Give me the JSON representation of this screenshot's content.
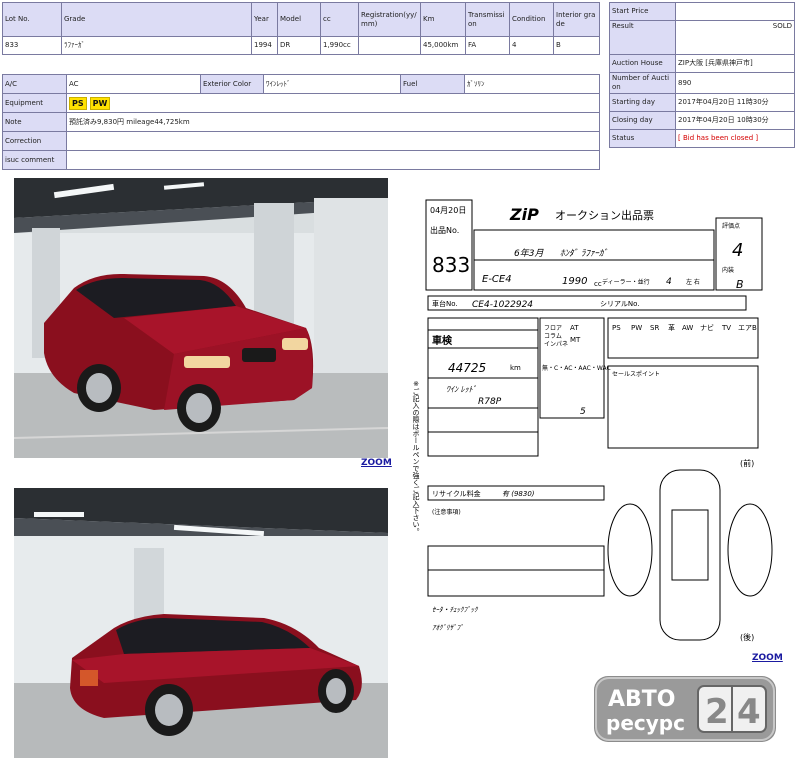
{
  "lot_table": {
    "headers": [
      "Lot No.",
      "Grade",
      "Year",
      "Model",
      "cc",
      "Registration(yy/mm)",
      "Km",
      "Transmission",
      "Condition",
      "Interior grade"
    ],
    "values": [
      "833",
      "ﾗﾌｧｰｶﾞ",
      "1994",
      "DR",
      "1,990cc",
      "",
      "45,000km",
      "FA",
      "4",
      "B"
    ]
  },
  "details": {
    "ac_label": "A/C",
    "ac_value": "AC",
    "exterior_color_label": "Exterior Color",
    "exterior_color_value": "ﾜｲﾝﾚｯﾄﾞ",
    "fuel_label": "Fuel",
    "fuel_value": "ｶﾞｿﾘﾝ",
    "equipment_label": "Equipment",
    "equipment_badges": [
      "PS",
      "PW"
    ],
    "note_label": "Note",
    "note_value": "預託済み9,830円 mileage44,725km",
    "correction_label": "Correction",
    "correction_value": "",
    "issue_comment_label": "isuc comment",
    "issue_comment_value": ""
  },
  "auction": {
    "start_price_label": "Start Price",
    "start_price_value": "",
    "result_label": "Result",
    "result_value": "SOLD",
    "auction_house_label": "Auction House",
    "auction_house_value": "ZIP大阪 [兵庫県神戸市]",
    "number_label": "Number of Auction",
    "number_value": "890",
    "starting_day_label": "Starting day",
    "starting_day_value": "2017年04月20日 11時30分",
    "closing_day_label": "Closing day",
    "closing_day_value": "2017年04月20日 10時30分",
    "status_label": "Status",
    "status_value": "[ Bid has been closed ]"
  },
  "zoom_label": "ZOOM",
  "sheet": {
    "date": "04月20日",
    "lot_label": "出品No.",
    "lot": "833",
    "title": "オークション出品票",
    "brand": "ZiP",
    "grade_score": "4",
    "interior_label": "内装",
    "interior_score": "B",
    "grade_label": "評価点",
    "model_text": "ﾎﾝﾀﾞ ﾗﾌｧｰｶﾞ",
    "year_text": "6年3月",
    "chassis_code": "E-CE4",
    "chassis_full": "CE4-1022924",
    "cc_text": "1990",
    "cc_unit": "cc",
    "dealer_label": "ディーラー・並行",
    "doors": "4",
    "handle": "左 右",
    "frame_label": "車台No.",
    "serial_label": "シリアルNo.",
    "shaken_label": "車検",
    "mileage_text": "44725",
    "mileage_unit": "km",
    "color_text": "ﾜｲﾝ ﾚｯﾄﾞ",
    "color_code": "R78P",
    "seats_text": "5",
    "recycle_label": "リサイクル料金",
    "recycle_value": "有 (9830)",
    "notes_label": "(注意事項)",
    "handwritten_1": "ｾｰﾀ・ﾁｪｯｸﾌﾞｯｸ",
    "handwritten_2": "ｱｵｸﾞﾘｻﾞﾌﾞ",
    "sales_point_label": "セールスポイント",
    "front_label": "(前)",
    "rear_label": "(後)",
    "option_labels": [
      "PS",
      "PW",
      "SR",
      "革",
      "AW",
      "ナビ",
      "TV",
      "エアB"
    ],
    "trans_labels": [
      "フロア",
      "コラム",
      "インパネ",
      "AT",
      "MT"
    ],
    "ac_options": "無・C・AC・AAC・WAC",
    "side_note": "※ご記入の際はボールペンで強くご記入下さい。"
  },
  "watermark": {
    "line1": "АВТО",
    "line2": "ресурс",
    "digits": [
      "2",
      "4"
    ]
  }
}
